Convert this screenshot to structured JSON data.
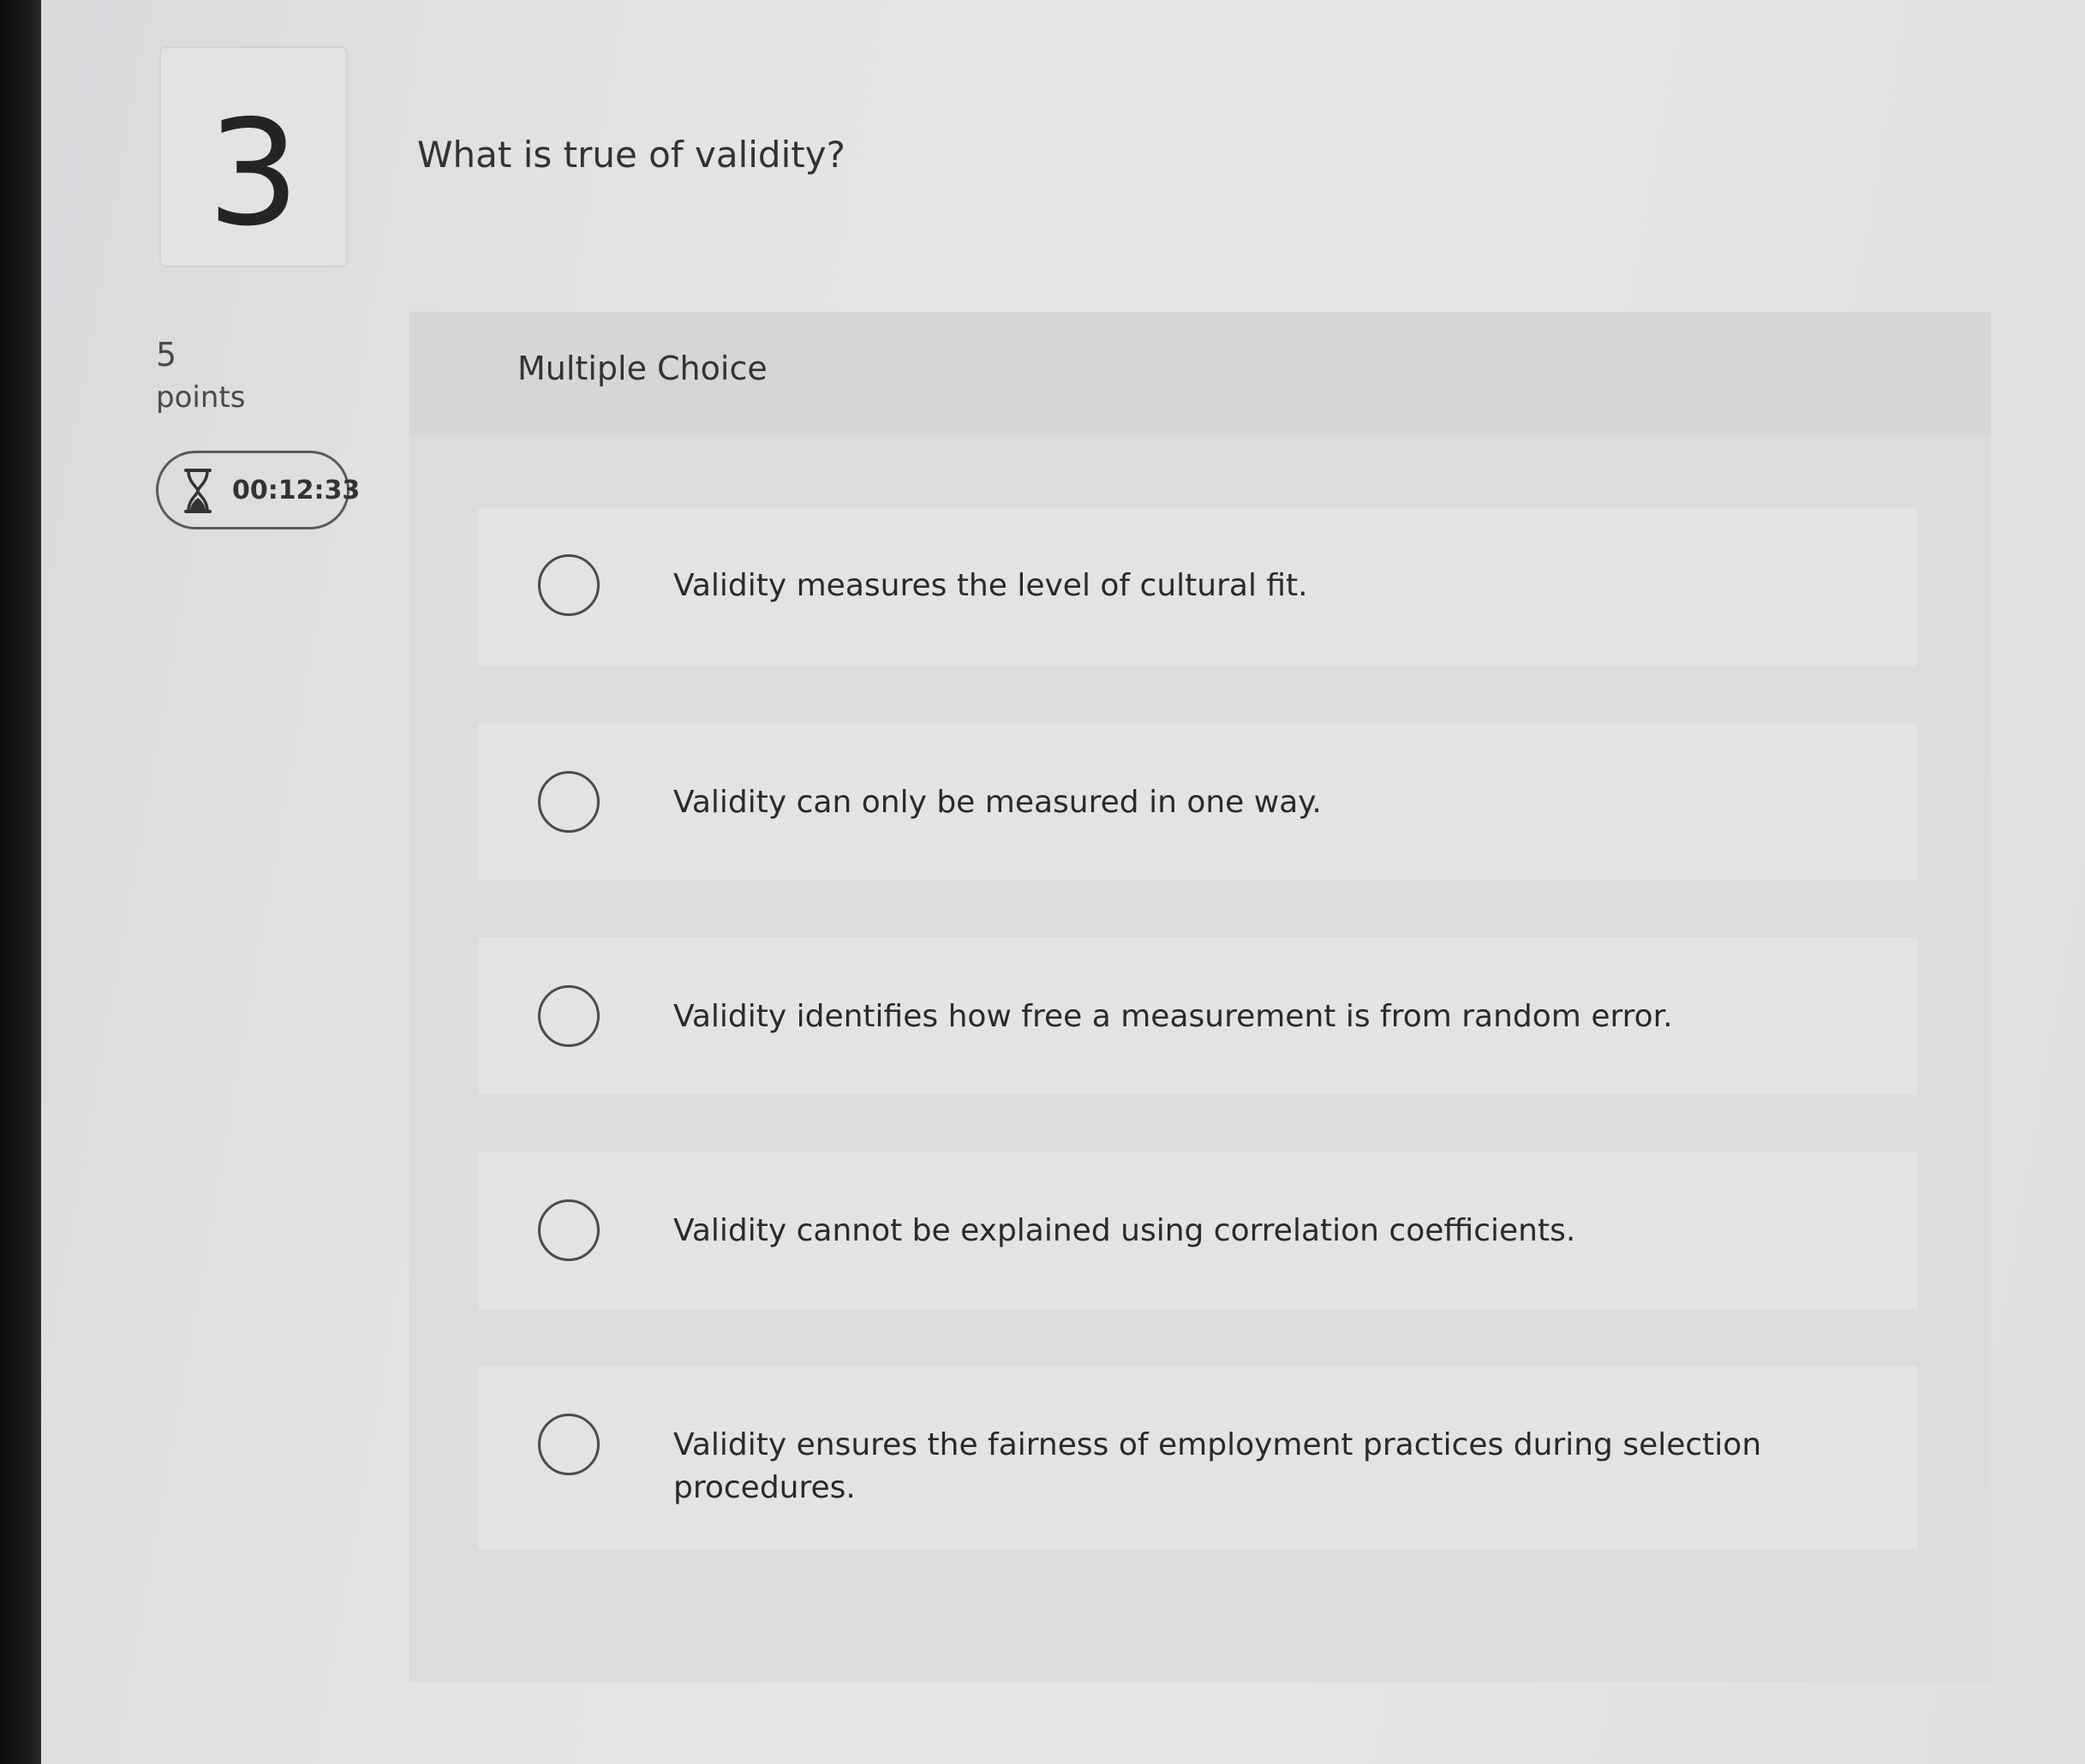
{
  "question": {
    "number": "3",
    "text": "What is true of validity?",
    "points_value": "5",
    "points_label": "points",
    "timer": "00:12:33"
  },
  "panel": {
    "type_label": "Multiple Choice",
    "options": [
      {
        "label": "Validity measures the level of cultural fit."
      },
      {
        "label": "Validity can only be measured in one way."
      },
      {
        "label": "Validity identifies how free a measurement is from random error."
      },
      {
        "label": "Validity cannot be explained using correlation coefficients."
      },
      {
        "label": "Validity ensures the fairness of employment practices during selection procedures."
      }
    ]
  },
  "icons": {
    "timer": "hourglass-icon",
    "option": "radio-button-icon"
  },
  "colors": {
    "background": "#e4e4e6",
    "panel": "#dcdcde",
    "text": "#2b2b2b"
  }
}
